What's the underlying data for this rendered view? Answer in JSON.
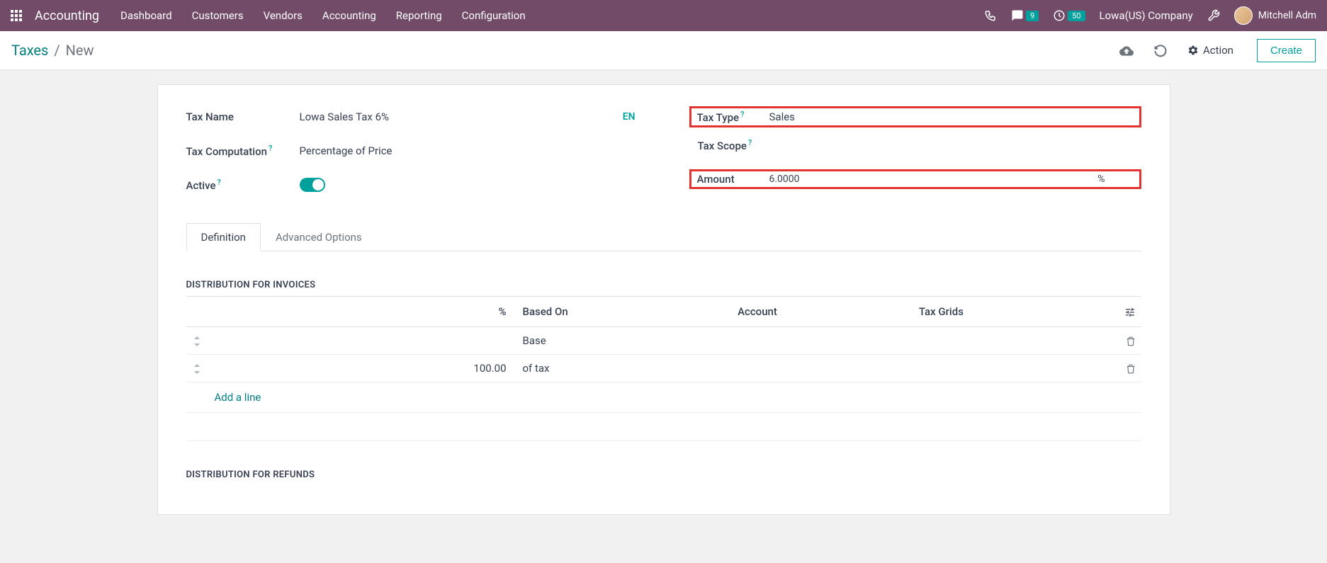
{
  "topnav": {
    "app_name": "Accounting",
    "menu": [
      "Dashboard",
      "Customers",
      "Vendors",
      "Accounting",
      "Reporting",
      "Configuration"
    ],
    "messages_count": "9",
    "activities_count": "50",
    "company": "Lowa(US) Company",
    "username": "Mitchell Adm"
  },
  "controlbar": {
    "breadcrumb_root": "Taxes",
    "breadcrumb_current": "New",
    "action_label": "Action",
    "create_label": "Create"
  },
  "form": {
    "tax_name_label": "Tax Name",
    "tax_name_value": "Lowa Sales Tax 6%",
    "lang": "EN",
    "tax_computation_label": "Tax Computation",
    "tax_computation_value": "Percentage of Price",
    "active_label": "Active",
    "tax_type_label": "Tax Type",
    "tax_type_value": "Sales",
    "tax_scope_label": "Tax Scope",
    "tax_scope_value": "",
    "amount_label": "Amount",
    "amount_value": "6.0000",
    "amount_unit": "%"
  },
  "tabs": {
    "definition": "Definition",
    "advanced": "Advanced Options"
  },
  "sections": {
    "invoices_title": "DISTRIBUTION FOR INVOICES",
    "refunds_title": "DISTRIBUTION FOR REFUNDS"
  },
  "table": {
    "col_pct": "%",
    "col_based_on": "Based On",
    "col_account": "Account",
    "col_tax_grids": "Tax Grids",
    "rows": [
      {
        "pct": "",
        "based_on": "Base"
      },
      {
        "pct": "100.00",
        "based_on": "of tax"
      }
    ],
    "add_line": "Add a line"
  }
}
